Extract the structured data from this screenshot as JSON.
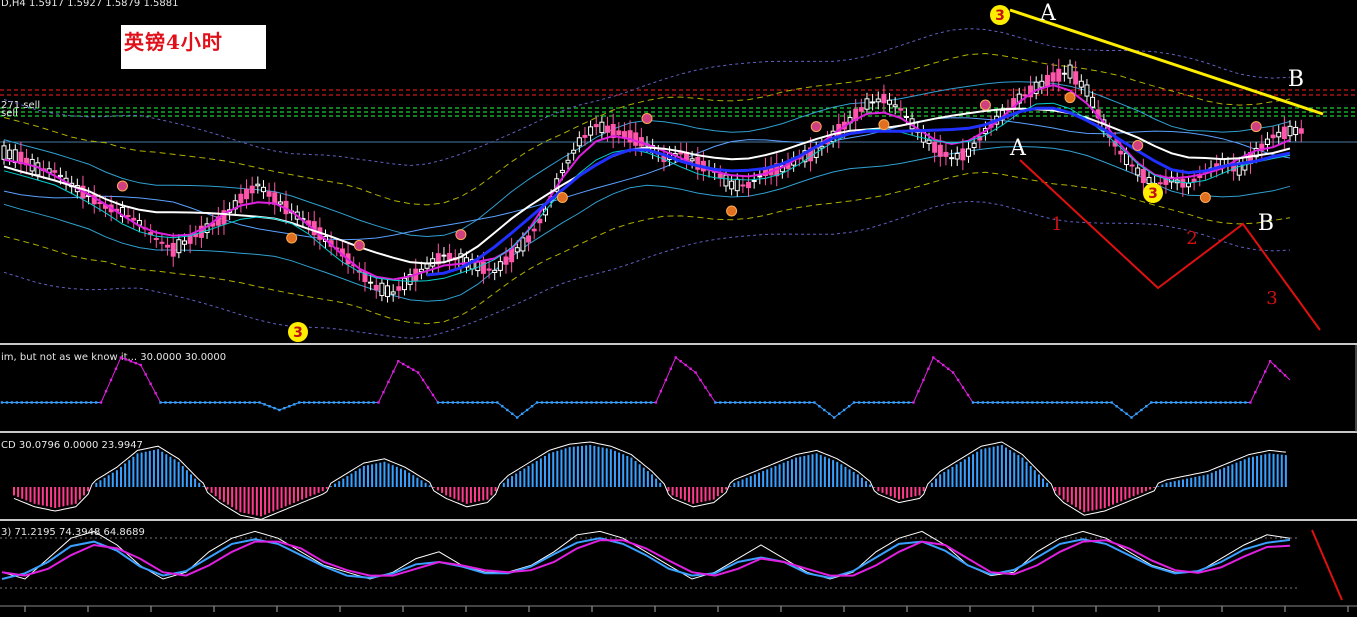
{
  "header": {
    "symbol_text": "D,H4  1.5917 1.5927 1.5879 1.5881",
    "title": "英镑4小时",
    "level_label_1": "271 sell",
    "level_label_2": "sell"
  },
  "annotations": {
    "wave_a_top": "A",
    "wave_a_low": "A",
    "wave_b_top": "B",
    "wave_b_low": "B",
    "wave_1": "1",
    "wave_2": "2",
    "wave_3": "3",
    "signal_3": "3"
  },
  "indicators": {
    "osc1_label": "im, but not as we know it... 30.0000 30.0000",
    "macd_label": "CD 30.0796 0.0000 23.9947",
    "stoch_label": "3) 71.2195 74.3948 64.8689"
  },
  "colors": {
    "background": "#000000",
    "bull": "#ffffff",
    "bear": "#ff55aa",
    "magenta_ma": "#e020e0",
    "blue_ma": "#2030ff",
    "white_ma": "#ffffff",
    "trendline": "#ffee00",
    "wave_lines": "#e01010",
    "histo_pos": "#3aa0ff",
    "histo_neg": "#ff3b8e"
  },
  "chart_data": {
    "type": "candlestick",
    "symbol": "GBP H4",
    "ohlc_header": {
      "open": 1.5917,
      "high": 1.5927,
      "low": 1.5879,
      "close": 1.5881
    },
    "close_path": [
      0.62,
      0.6,
      0.56,
      0.55,
      0.5,
      0.46,
      0.42,
      0.4,
      0.36,
      0.3,
      0.26,
      0.3,
      0.34,
      0.38,
      0.45,
      0.5,
      0.45,
      0.4,
      0.36,
      0.3,
      0.25,
      0.18,
      0.12,
      0.1,
      0.15,
      0.2,
      0.24,
      0.22,
      0.2,
      0.18,
      0.24,
      0.3,
      0.4,
      0.55,
      0.66,
      0.72,
      0.7,
      0.68,
      0.65,
      0.6,
      0.62,
      0.58,
      0.55,
      0.5,
      0.5,
      0.55,
      0.56,
      0.6,
      0.62,
      0.68,
      0.74,
      0.8,
      0.82,
      0.78,
      0.7,
      0.64,
      0.6,
      0.62,
      0.7,
      0.76,
      0.82,
      0.86,
      0.9,
      0.92,
      0.85,
      0.72,
      0.62,
      0.55,
      0.5,
      0.52,
      0.5,
      0.55,
      0.58,
      0.56,
      0.62,
      0.68,
      0.7
    ],
    "osc_levels": [
      0.3,
      0.3,
      0.3,
      0.3,
      0.3,
      0.3,
      0.9,
      0.8,
      0.3,
      0.3,
      0.3,
      0.3,
      0.3,
      0.3,
      0.2,
      0.3,
      0.3,
      0.3,
      0.3,
      0.3,
      0.85,
      0.7,
      0.3,
      0.3,
      0.3,
      0.3,
      0.1,
      0.3,
      0.3,
      0.3,
      0.3,
      0.3,
      0.3,
      0.3,
      0.9,
      0.7,
      0.3,
      0.3,
      0.3,
      0.3,
      0.3,
      0.3,
      0.1,
      0.3,
      0.3,
      0.3,
      0.3,
      0.9,
      0.7,
      0.3,
      0.3,
      0.3,
      0.3,
      0.3,
      0.3,
      0.3,
      0.3,
      0.1,
      0.3,
      0.3,
      0.3,
      0.3,
      0.3,
      0.3,
      0.85,
      0.6
    ],
    "macd_hist": [
      -0.2,
      -0.4,
      -0.5,
      -0.4,
      0.1,
      0.4,
      0.8,
      0.9,
      0.6,
      0.1,
      -0.3,
      -0.6,
      -0.7,
      -0.5,
      -0.3,
      -0.1,
      0.2,
      0.5,
      0.6,
      0.4,
      0.1,
      -0.2,
      -0.4,
      -0.3,
      0.2,
      0.5,
      0.8,
      0.95,
      1.0,
      0.9,
      0.7,
      0.3,
      -0.2,
      -0.4,
      -0.3,
      0.1,
      0.3,
      0.5,
      0.7,
      0.8,
      0.6,
      0.3,
      -0.1,
      -0.3,
      -0.2,
      0.3,
      0.6,
      0.9,
      1.0,
      0.7,
      0.2,
      -0.3,
      -0.6,
      -0.5,
      -0.3,
      -0.1,
      0.1,
      0.2,
      0.3,
      0.5,
      0.7,
      0.8,
      0.75
    ],
    "stoch_main": [
      0.3,
      0.2,
      0.5,
      0.8,
      0.9,
      0.7,
      0.4,
      0.2,
      0.3,
      0.6,
      0.8,
      0.9,
      0.8,
      0.6,
      0.4,
      0.3,
      0.2,
      0.3,
      0.5,
      0.6,
      0.4,
      0.3,
      0.3,
      0.4,
      0.6,
      0.85,
      0.9,
      0.8,
      0.6,
      0.4,
      0.2,
      0.3,
      0.5,
      0.7,
      0.5,
      0.3,
      0.2,
      0.3,
      0.6,
      0.8,
      0.9,
      0.7,
      0.4,
      0.25,
      0.3,
      0.6,
      0.8,
      0.9,
      0.8,
      0.6,
      0.4,
      0.3,
      0.3,
      0.5,
      0.7,
      0.85,
      0.8
    ],
    "stoch_signal": [
      0.35,
      0.3,
      0.4,
      0.6,
      0.75,
      0.7,
      0.55,
      0.35,
      0.3,
      0.45,
      0.65,
      0.8,
      0.8,
      0.7,
      0.5,
      0.38,
      0.3,
      0.3,
      0.4,
      0.5,
      0.45,
      0.38,
      0.35,
      0.38,
      0.5,
      0.7,
      0.82,
      0.82,
      0.7,
      0.52,
      0.35,
      0.3,
      0.4,
      0.55,
      0.5,
      0.4,
      0.3,
      0.3,
      0.45,
      0.65,
      0.8,
      0.75,
      0.55,
      0.35,
      0.32,
      0.45,
      0.65,
      0.8,
      0.82,
      0.7,
      0.52,
      0.38,
      0.34,
      0.42,
      0.58,
      0.72,
      0.74
    ]
  }
}
